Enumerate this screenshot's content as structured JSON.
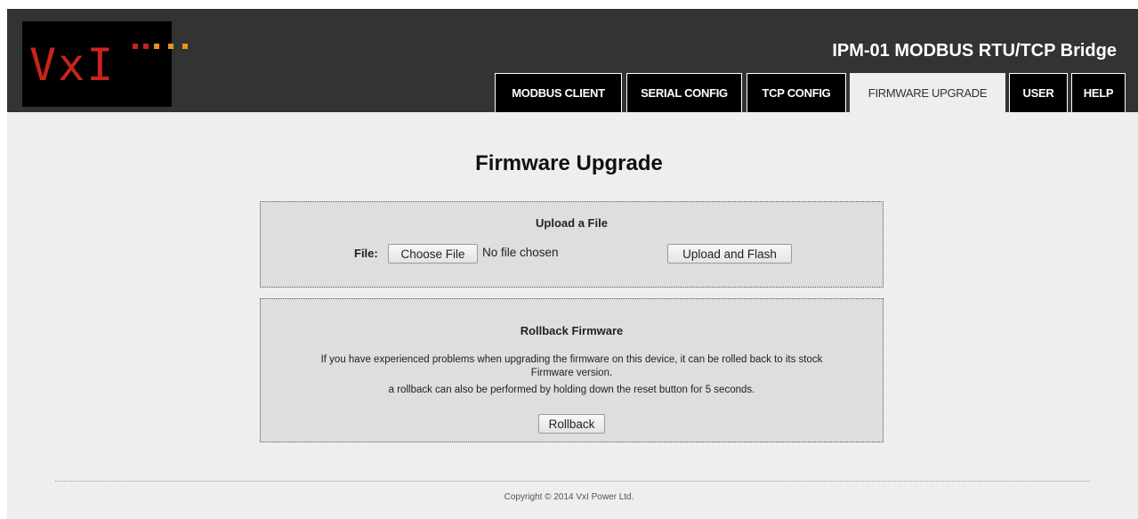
{
  "header": {
    "logo_text": "VxI",
    "product_title": "IPM-01 MODBUS RTU/TCP Bridge",
    "background": "#333333",
    "brand_red": "#c8241b",
    "brand_orange": "#e8951a"
  },
  "nav": {
    "tabs": [
      {
        "label": "MODBUS CLIENT",
        "active": false
      },
      {
        "label": "SERIAL CONFIG",
        "active": false
      },
      {
        "label": "TCP CONFIG",
        "active": false
      },
      {
        "label": "FIRMWARE UPGRADE",
        "active": true
      },
      {
        "label": "USER",
        "active": false
      },
      {
        "label": "HELP",
        "active": false
      }
    ]
  },
  "main": {
    "title": "Firmware Upgrade",
    "upload": {
      "title": "Upload a File",
      "file_label": "File:",
      "choose_button": "Choose File",
      "no_file_text": "No file chosen",
      "upload_button": "Upload and Flash"
    },
    "rollback": {
      "title": "Rollback Firmware",
      "line1": "If you have experienced problems when upgrading the firmware on this device, it can be rolled back to its stock",
      "line2": "Firmware version.",
      "line3": "a rollback can also be performed by holding down the reset button for 5 seconds.",
      "button": "Rollback"
    }
  },
  "footer": {
    "copyright": "Copyright © 2014 VxI Power Ltd."
  }
}
